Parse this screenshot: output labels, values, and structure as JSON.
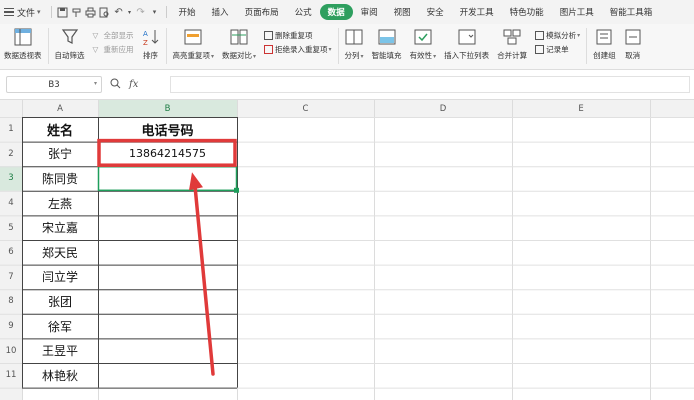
{
  "menubar": {
    "file_label": "文件",
    "tabs": [
      "开始",
      "插入",
      "页面布局",
      "公式",
      "数据",
      "审阅",
      "视图",
      "安全",
      "开发工具",
      "特色功能",
      "图片工具",
      "智能工具箱"
    ],
    "active_tab": "数据"
  },
  "ribbon": {
    "pivot": "数据透视表",
    "autofilter": "自动筛选",
    "show_all": "全部显示",
    "reapply": "重新应用",
    "sort": "排序",
    "highlight_dup": "高亮重复项",
    "compare": "数据对比",
    "remove_dup": "删除重复项",
    "reject_dup": "拒绝录入重复项",
    "split": "分列",
    "smart_fill": "智能填充",
    "validity": "有效性",
    "dropdown_list": "插入下拉列表",
    "consolidate": "合并计算",
    "simulate": "模拟分析",
    "record_form": "记录单",
    "create_group": "创建组",
    "ungroup": "取消"
  },
  "formula_bar": {
    "name_box": "B3",
    "fx": "fx",
    "formula": ""
  },
  "sheet": {
    "columns": [
      "A",
      "B",
      "C",
      "D",
      "E"
    ],
    "rows": [
      "1",
      "2",
      "3",
      "4",
      "5",
      "6",
      "7",
      "8",
      "9",
      "10",
      "11"
    ],
    "header_name": "姓名",
    "header_phone": "电话号码",
    "names": [
      "张宁",
      "陈同贵",
      "左燕",
      "宋立嘉",
      "郑天民",
      "闫立学",
      "张团",
      "徐军",
      "王昱平",
      "林艳秋"
    ],
    "phones": [
      "13864214575",
      "",
      "",
      "",
      "",
      "",
      "",
      "",
      "",
      ""
    ]
  },
  "colors": {
    "active_tab": "#2e9f5f",
    "annotation_red": "#e03a3a",
    "selection_green": "#1e9e5b"
  }
}
